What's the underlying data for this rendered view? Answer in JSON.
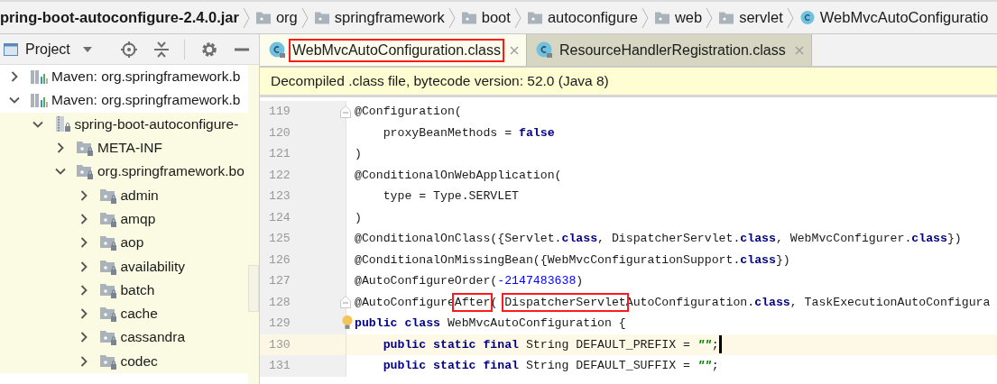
{
  "breadcrumb": [
    {
      "kind": "jar",
      "label": "pring-boot-autoconfigure-2.4.0.jar"
    },
    {
      "kind": "folder",
      "label": "org"
    },
    {
      "kind": "folder",
      "label": "springframework"
    },
    {
      "kind": "folder",
      "label": "boot"
    },
    {
      "kind": "folder",
      "label": "autoconfigure"
    },
    {
      "kind": "folder",
      "label": "web"
    },
    {
      "kind": "folder",
      "label": "servlet"
    },
    {
      "kind": "class",
      "label": "WebMvcAutoConfiguratio"
    }
  ],
  "project_panel": {
    "title": "Project",
    "tree": [
      {
        "kind": "library",
        "label": "Maven: org.springframework.b",
        "expanded": false
      },
      {
        "kind": "library",
        "label": "Maven: org.springframework.b",
        "expanded": true,
        "children": [
          {
            "kind": "jar",
            "label": "spring-boot-autoconfigure-",
            "expanded": true,
            "children": [
              {
                "kind": "folder",
                "label": "META-INF",
                "expanded": false
              },
              {
                "kind": "folder",
                "label": "org.springframework.bo",
                "expanded": true,
                "children": [
                  {
                    "kind": "folder",
                    "label": "admin",
                    "expanded": false
                  },
                  {
                    "kind": "folder",
                    "label": "amqp",
                    "expanded": false
                  },
                  {
                    "kind": "folder",
                    "label": "aop",
                    "expanded": false
                  },
                  {
                    "kind": "folder",
                    "label": "availability",
                    "expanded": false
                  },
                  {
                    "kind": "folder",
                    "label": "batch",
                    "expanded": false
                  },
                  {
                    "kind": "folder",
                    "label": "cache",
                    "expanded": false
                  },
                  {
                    "kind": "folder",
                    "label": "cassandra",
                    "expanded": false
                  },
                  {
                    "kind": "folder",
                    "label": "codec",
                    "expanded": false
                  }
                ]
              }
            ]
          }
        ]
      }
    ]
  },
  "tabs": [
    {
      "label": "WebMvcAutoConfiguration.class",
      "selected": true,
      "boxed": true
    },
    {
      "label": "ResourceHandlerRegistration.class",
      "selected": false,
      "boxed": false
    }
  ],
  "banner": "Decompiled .class file, bytecode version: 52.0 (Java 8)",
  "editor": {
    "lines": [
      {
        "number": "119",
        "fold": true,
        "current": false,
        "bulb": false,
        "caret": false,
        "tokens": [
          {
            "kind": "plain",
            "text": "@Configuration("
          }
        ]
      },
      {
        "number": "120",
        "fold": false,
        "current": false,
        "bulb": false,
        "caret": false,
        "tokens": [
          {
            "kind": "plain",
            "text": "    proxyBeanMethods = "
          },
          {
            "kind": "keyword",
            "text": "false"
          }
        ]
      },
      {
        "number": "121",
        "fold": false,
        "current": false,
        "bulb": false,
        "caret": false,
        "tokens": [
          {
            "kind": "plain",
            "text": ")"
          }
        ]
      },
      {
        "number": "122",
        "fold": false,
        "current": false,
        "bulb": false,
        "caret": false,
        "tokens": [
          {
            "kind": "plain",
            "text": "@ConditionalOnWebApplication("
          }
        ]
      },
      {
        "number": "123",
        "fold": false,
        "current": false,
        "bulb": false,
        "caret": false,
        "tokens": [
          {
            "kind": "plain",
            "text": "    type = Type.SERVLET"
          }
        ]
      },
      {
        "number": "124",
        "fold": false,
        "current": false,
        "bulb": false,
        "caret": false,
        "tokens": [
          {
            "kind": "plain",
            "text": ")"
          }
        ]
      },
      {
        "number": "125",
        "fold": false,
        "current": false,
        "bulb": false,
        "caret": false,
        "tokens": [
          {
            "kind": "plain",
            "text": "@ConditionalOnClass({Servlet."
          },
          {
            "kind": "keyword",
            "text": "class"
          },
          {
            "kind": "plain",
            "text": ", DispatcherServlet."
          },
          {
            "kind": "keyword",
            "text": "class"
          },
          {
            "kind": "plain",
            "text": ", WebMvcConfigurer."
          },
          {
            "kind": "keyword",
            "text": "class"
          },
          {
            "kind": "plain",
            "text": "})"
          }
        ]
      },
      {
        "number": "126",
        "fold": false,
        "current": false,
        "bulb": false,
        "caret": false,
        "tokens": [
          {
            "kind": "plain",
            "text": "@ConditionalOnMissingBean({WebMvcConfigurationSupport."
          },
          {
            "kind": "keyword",
            "text": "class"
          },
          {
            "kind": "plain",
            "text": "})"
          }
        ]
      },
      {
        "number": "127",
        "fold": false,
        "current": false,
        "bulb": false,
        "caret": false,
        "tokens": [
          {
            "kind": "plain",
            "text": "@AutoConfigureOrder("
          },
          {
            "kind": "number",
            "text": "-2147483638"
          },
          {
            "kind": "plain",
            "text": ")"
          }
        ]
      },
      {
        "number": "128",
        "fold": true,
        "current": false,
        "bulb": false,
        "caret": false,
        "tokens": [
          {
            "kind": "plain",
            "text": "@AutoConfigure"
          },
          {
            "kind": "boxed",
            "text": "After"
          },
          {
            "kind": "plain",
            "text": "( "
          },
          {
            "kind": "boxed",
            "text": "DispatcherServlet"
          },
          {
            "kind": "plain",
            "text": "AutoConfiguration."
          },
          {
            "kind": "keyword",
            "text": "class"
          },
          {
            "kind": "plain",
            "text": ", TaskExecutionAutoConfigura"
          }
        ]
      },
      {
        "number": "129",
        "fold": false,
        "current": false,
        "bulb": true,
        "caret": false,
        "tokens": [
          {
            "kind": "keyword",
            "text": "public class"
          },
          {
            "kind": "plain",
            "text": " WebMvcAutoConfiguration {"
          }
        ]
      },
      {
        "number": "130",
        "fold": false,
        "current": true,
        "bulb": false,
        "caret": true,
        "tokens": [
          {
            "kind": "keyword",
            "text": "    public static final"
          },
          {
            "kind": "plain",
            "text": " String DEFAULT_PREFIX = "
          },
          {
            "kind": "string",
            "text": "\"\""
          },
          {
            "kind": "plain",
            "text": ";"
          }
        ]
      },
      {
        "number": "131",
        "fold": false,
        "current": false,
        "bulb": false,
        "caret": false,
        "tokens": [
          {
            "kind": "keyword",
            "text": "    public static final"
          },
          {
            "kind": "plain",
            "text": " String DEFAULT_SUFFIX = "
          },
          {
            "kind": "string",
            "text": "\"\""
          },
          {
            "kind": "plain",
            "text": ";"
          }
        ]
      }
    ]
  }
}
